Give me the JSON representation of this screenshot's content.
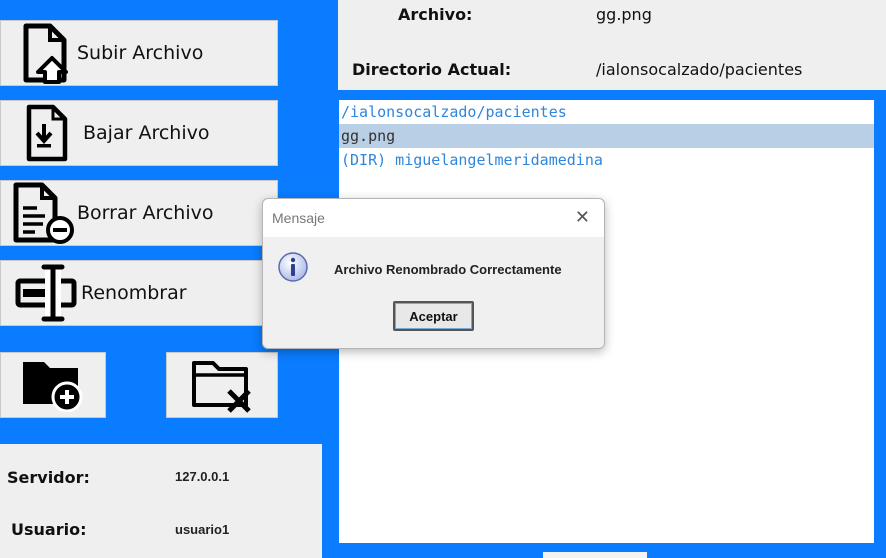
{
  "sidebar": {
    "upload_label": "Subir Archivo",
    "download_label": "Bajar Archivo",
    "delete_label": "Borrar Archivo",
    "rename_label": "Renombrar"
  },
  "info": {
    "server_label": "Servidor:",
    "server_value": "127.0.0.1",
    "user_label": "Usuario:",
    "user_value": "usuario1"
  },
  "header": {
    "file_label": "Archivo:",
    "file_value": "gg.png",
    "dir_label": "Directorio Actual:",
    "dir_value": "/ialonsocalzado/pacientes"
  },
  "file_list": [
    "/ialonsocalzado/pacientes",
    "gg.png",
    "(DIR) miguelangelmeridamedina"
  ],
  "selected_index": 1,
  "dialog": {
    "title": "Mensaje",
    "message": "Archivo Renombrado Correctamente",
    "ok_label": "Aceptar"
  },
  "colors": {
    "background": "#0a7cff",
    "panel": "#efefef",
    "list_text": "#2e86de",
    "selection": "#b8cfe5"
  }
}
